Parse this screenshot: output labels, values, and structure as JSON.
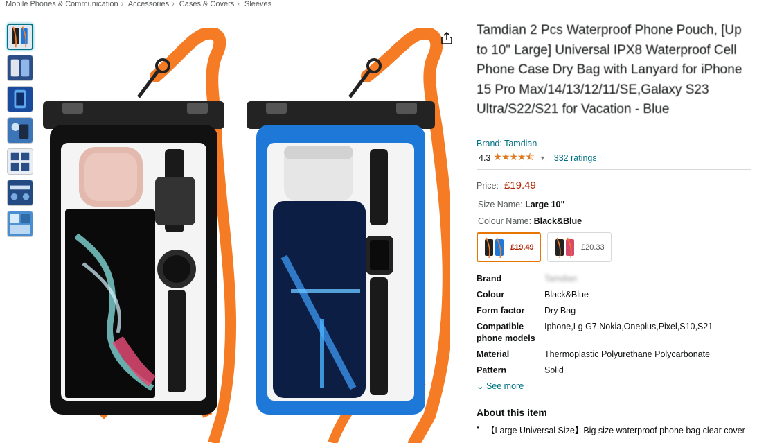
{
  "breadcrumb": [
    "Mobile Phones & Communication",
    "Accessories",
    "Cases & Covers",
    "Sleeves"
  ],
  "thumbnails": [
    {
      "name": "thumb-1",
      "active": true
    },
    {
      "name": "thumb-2",
      "active": false
    },
    {
      "name": "thumb-3",
      "active": false
    },
    {
      "name": "thumb-4",
      "active": false
    },
    {
      "name": "thumb-5",
      "active": false
    },
    {
      "name": "thumb-6",
      "active": false
    },
    {
      "name": "thumb-7",
      "active": false
    }
  ],
  "icons": {
    "share": "share-icon",
    "chevron": "chevron-down-icon",
    "star": "star-icon"
  },
  "product": {
    "title": "Tamdian 2 Pcs Waterproof Phone Pouch, [Up to 10\" Large] Universal IPX8 Waterproof Cell Phone Case Dry Bag with Lanyard for iPhone 15 Pro Max/14/13/12/11/SE,Galaxy S23 Ultra/S22/S21 for Vacation - Blue",
    "brand_label": "Brand: Tamdian",
    "rating_value": "4.3",
    "stars": "★★★★⯪",
    "ratings_count": "332 ratings",
    "price_label": "Price:",
    "price": "£19.49",
    "size_label": "Size Name:",
    "size_value": "Large 10\"",
    "colour_label": "Colour Name:",
    "colour_value": "Black&Blue"
  },
  "swatches": [
    {
      "price": "£19.49",
      "selected": true
    },
    {
      "price": "£20.33",
      "selected": false
    }
  ],
  "specs": [
    {
      "key": "Brand",
      "value": "Tamdian",
      "blurred": true
    },
    {
      "key": "Colour",
      "value": "Black&Blue"
    },
    {
      "key": "Form factor",
      "value": "Dry Bag"
    },
    {
      "key": "Compatible phone models",
      "value": "Iphone,Lg G7,Nokia,Oneplus,Pixel,S10,S21"
    },
    {
      "key": "Material",
      "value": "Thermoplastic Polyurethane Polycarbonate"
    },
    {
      "key": "Pattern",
      "value": "Solid"
    }
  ],
  "see_more": "See more",
  "about": {
    "title": "About this item",
    "items": [
      "【Large Universal Size】Big size waterproof phone bag clear cover"
    ]
  },
  "colors": {
    "link": "#007185",
    "price": "#b12704",
    "star": "#de7921",
    "lanyard": "#f57c24",
    "pouch_blue": "#1e78d8"
  }
}
